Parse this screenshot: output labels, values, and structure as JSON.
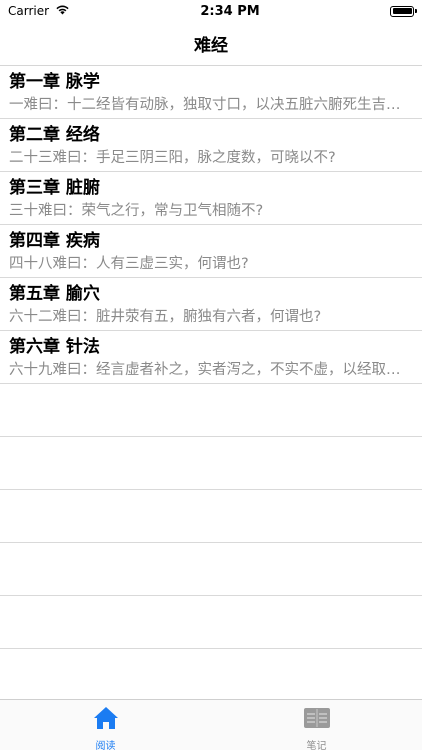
{
  "status": {
    "carrier": "Carrier",
    "time": "2:34 PM"
  },
  "nav": {
    "title": "难经"
  },
  "chapters": [
    {
      "title": "第一章 脉学",
      "subtitle": "一难曰：十二经皆有动脉，独取寸口，以决五脏六腑死生吉凶之法，何谓也？"
    },
    {
      "title": "第二章 经络",
      "subtitle": "二十三难曰：手足三阴三阳，脉之度数，可晓以不?"
    },
    {
      "title": "第三章 脏腑",
      "subtitle": "三十难曰：荣气之行，常与卫气相随不?"
    },
    {
      "title": "第四章 疾病",
      "subtitle": "四十八难曰：人有三虚三实，何谓也?"
    },
    {
      "title": "第五章 腧穴",
      "subtitle": "六十二难曰：脏井荥有五，腑独有六者，何谓也?"
    },
    {
      "title": "第六章 针法",
      "subtitle": "六十九难曰：经言虚者补之，实者泻之，不实不虚，以经取之，何谓也？"
    }
  ],
  "tabs": [
    {
      "label": "阅读",
      "icon": "home-icon",
      "active": true,
      "color": "#1b7cf2"
    },
    {
      "label": "笔记",
      "icon": "notes-icon",
      "active": false,
      "color": "#8e8e8e"
    }
  ]
}
